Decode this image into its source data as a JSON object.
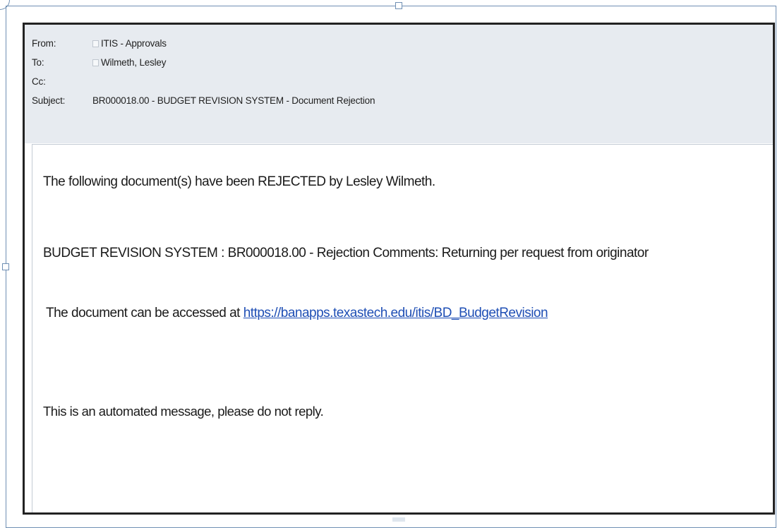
{
  "email": {
    "header": {
      "from_label": "From:",
      "from_value": "ITIS - Approvals",
      "to_label": "To:",
      "to_value": "Wilmeth, Lesley",
      "cc_label": "Cc:",
      "cc_value": "",
      "subject_label": "Subject:",
      "subject_value": "BR000018.00 - BUDGET REVISION SYSTEM - Document Rejection"
    },
    "body": {
      "line1": "The following document(s) have been REJECTED by Lesley Wilmeth.",
      "line2": "BUDGET REVISION SYSTEM : BR000018.00 - Rejection Comments:  Returning per request from originator",
      "line3_prefix": "The document can be accessed at ",
      "line3_link": "https://banapps.texastech.edu/itis/BD_BudgetRevision",
      "line4": "This is an automated message, please do not reply."
    }
  },
  "colors": {
    "header_bg": "#e7ebf0",
    "link": "#1f4fb5",
    "frame": "#6f8fb3"
  }
}
